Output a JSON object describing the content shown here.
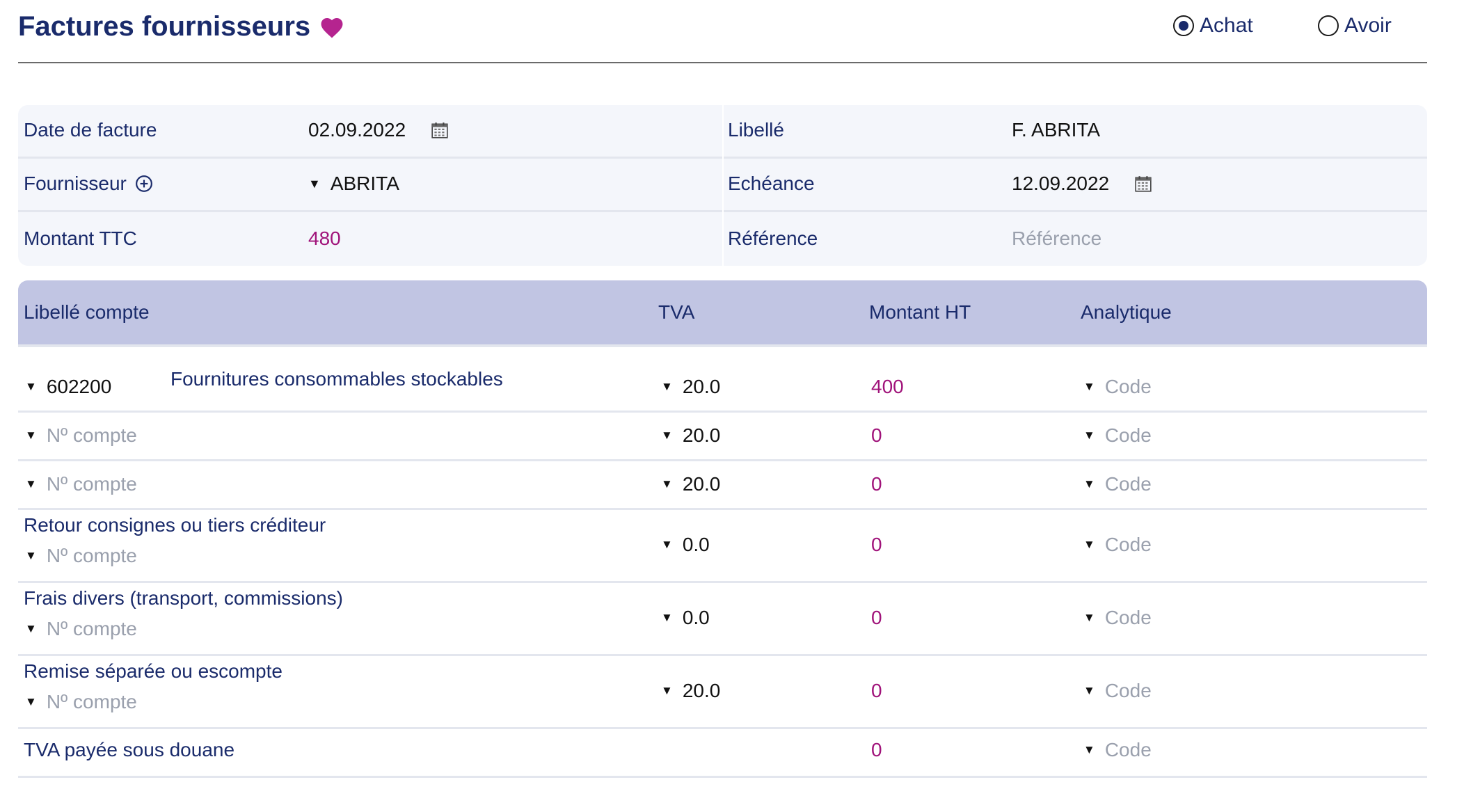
{
  "header": {
    "title": "Factures fournisseurs",
    "heart_color": "#b5248f",
    "radio_options": [
      {
        "label": "Achat",
        "selected": true
      },
      {
        "label": "Avoir",
        "selected": false
      }
    ]
  },
  "form": {
    "invoice_date_label": "Date de facture",
    "invoice_date_value": "02.09.2022",
    "supplier_label": "Fournisseur",
    "supplier_value": "ABRITA",
    "amount_ttc_label": "Montant TTC",
    "amount_ttc_value": "480",
    "libelle_label": "Libellé",
    "libelle_value": "F. ABRITA",
    "due_label": "Echéance",
    "due_value": "12.09.2022",
    "reference_label": "Référence",
    "reference_placeholder": "Référence"
  },
  "table": {
    "headers": {
      "account": "Libellé compte",
      "tva": "TVA",
      "amount_ht": "Montant HT",
      "analytic": "Analytique"
    },
    "rows": [
      {
        "label": "",
        "account": "602200",
        "account_name": "Fournitures consommables stockables",
        "account_placeholder": "",
        "tva": "20.0",
        "amount": "400",
        "code": "Code"
      },
      {
        "label": "",
        "account": "",
        "account_name": "",
        "account_placeholder": "Nº compte",
        "tva": "20.0",
        "amount": "0",
        "code": "Code"
      },
      {
        "label": "",
        "account": "",
        "account_name": "",
        "account_placeholder": "Nº compte",
        "tva": "20.0",
        "amount": "0",
        "code": "Code"
      },
      {
        "label": "Retour consignes ou tiers créditeur",
        "account": "",
        "account_name": "",
        "account_placeholder": "Nº compte",
        "tva": "0.0",
        "amount": "0",
        "code": "Code"
      },
      {
        "label": "Frais divers (transport, commissions)",
        "account": "",
        "account_name": "",
        "account_placeholder": "Nº compte",
        "tva": "0.0",
        "amount": "0",
        "code": "Code"
      },
      {
        "label": "Remise séparée ou escompte",
        "account": "",
        "account_name": "",
        "account_placeholder": "Nº compte",
        "tva": "20.0",
        "amount": "0",
        "code": "Code"
      },
      {
        "label": "TVA payée sous douane",
        "account": "",
        "account_name": "",
        "account_placeholder": "",
        "tva": "",
        "amount": "0",
        "code": "Code"
      }
    ]
  },
  "colors": {
    "primary_text": "#1a2b6b",
    "accent_magenta": "#a0137a",
    "table_header_bg": "#c1c5e3",
    "form_bg": "#f4f6fb",
    "placeholder": "#9aa0ad"
  }
}
